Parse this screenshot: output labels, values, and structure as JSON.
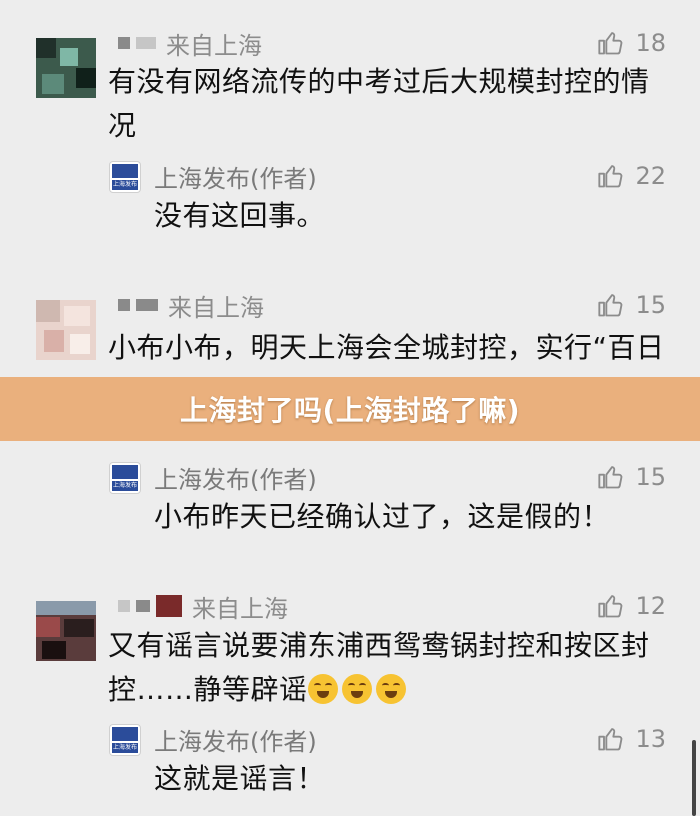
{
  "comments": [
    {
      "from": "来自上海",
      "likes": "18",
      "text": "有没有网络流传的中考过后大规模封控的情况",
      "reply": {
        "author": "上海发布(作者)",
        "likes": "22",
        "text": "没有这回事。"
      }
    },
    {
      "from": "来自上海",
      "likes": "15",
      "text": "小布小布，明天上海会全城封控，实行“百日行动”吗？",
      "reply": {
        "author": "上海发布(作者)",
        "likes": "15",
        "text": "小布昨天已经确认过了，这是假的！"
      }
    },
    {
      "from": "来自上海",
      "likes": "12",
      "text": "又有谣言说要浦东浦西鸳鸯锅封控和按区封控……静等辟谣",
      "reply": {
        "author": "上海发布(作者)",
        "likes": "13",
        "text": "这就是谣言！"
      }
    }
  ],
  "banner": "上海封了吗(上海封路了嘛)",
  "logo_text": "上海发布",
  "icons": {
    "like": "thumbs-up-icon",
    "emoji": "crying-laughing-emoji-icon"
  },
  "colors": {
    "background": "#ededed",
    "banner": "#eab07d",
    "muted_text": "#8c8c8c"
  }
}
